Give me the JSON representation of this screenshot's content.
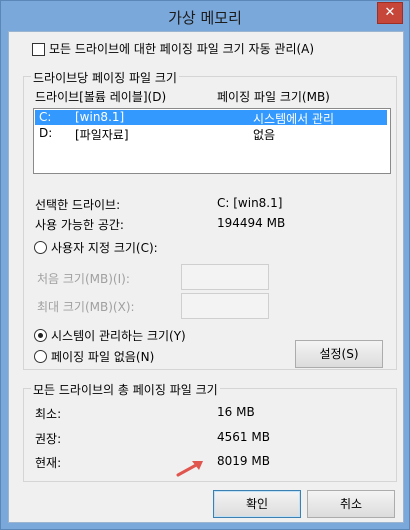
{
  "window": {
    "title": "가상 메모리",
    "close_glyph": "✕"
  },
  "auto_manage": {
    "label": "모든 드라이브에 대한 페이징 파일 크기 자동 관리(A)",
    "checked": false
  },
  "per_drive": {
    "legend": "드라이브당 페이징 파일 크기",
    "col_drive": "드라이브[볼륨 레이블](D)",
    "col_size": "페이징 파일 크기(MB)",
    "rows": [
      {
        "drive": "C:",
        "label": "[win8.1]",
        "size": "시스템에서 관리",
        "selected": true
      },
      {
        "drive": "D:",
        "label": "[파일자료]",
        "size": "없음",
        "selected": false
      }
    ],
    "selected_drive_label": "선택한 드라이브:",
    "selected_drive_value": "C:  [win8.1]",
    "free_space_label": "사용 가능한 공간:",
    "free_space_value": "194494 MB",
    "custom_size": "사용자 지정 크기(C):",
    "initial_size": "처음 크기(MB)(I):",
    "max_size": "최대 크기(MB)(X):",
    "system_managed": "시스템이 관리하는 크기(Y)",
    "no_paging": "페이징 파일 없음(N)",
    "set_button": "설정(S)"
  },
  "totals": {
    "legend": "모든 드라이브의 총 페이징 파일 크기",
    "min_label": "최소:",
    "min_value": "16 MB",
    "recommended_label": "권장:",
    "recommended_value": "4561 MB",
    "current_label": "현재:",
    "current_value": "8019 MB"
  },
  "buttons": {
    "ok": "확인",
    "cancel": "취소"
  },
  "colors": {
    "accent": "#3399ff",
    "arrow": "#e0554e"
  }
}
